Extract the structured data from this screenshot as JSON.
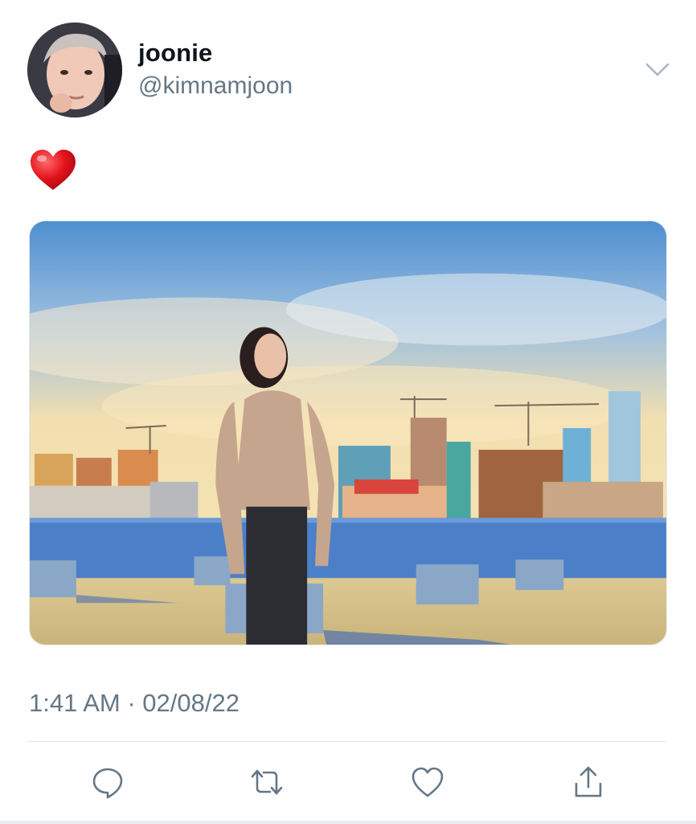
{
  "tweet": {
    "author": {
      "display_name": "joonie",
      "handle": "@kimnamjoon",
      "avatar_icon": "profile-photo"
    },
    "text_emoji": "❤️",
    "media_description_icon": "photo",
    "timestamp": "1:41 AM · 02/08/22"
  },
  "actions": {
    "reply_icon": "reply-icon",
    "retweet_icon": "retweet-icon",
    "like_icon": "heart-icon",
    "share_icon": "share-icon"
  },
  "colors": {
    "secondary_text": "#657786",
    "icon_gray": "#657786",
    "heart_red": "#e0245e",
    "divider": "#e1e8ed"
  }
}
